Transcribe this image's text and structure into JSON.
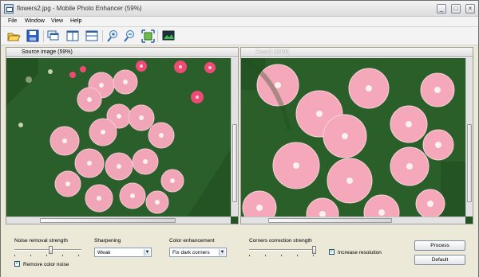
{
  "window": {
    "title": "flowers2.jpg - Mobile Photo Enhancer (59%)",
    "controls": [
      "_",
      "□",
      "×"
    ]
  },
  "menu": [
    "File",
    "Window",
    "View",
    "Help"
  ],
  "toolbar": {
    "buttons": [
      "open-folder-icon",
      "save-icon",
      "cascade-windows-icon",
      "split-vertical-icon",
      "split-horizontal-icon",
      "zoom-in-icon",
      "zoom-out-icon",
      "fit-to-window-icon",
      "show-original-icon"
    ]
  },
  "source_panel": {
    "title": "Source image (59%)"
  },
  "result_panel": {
    "title": "Result (59%)"
  },
  "controls": {
    "noise": {
      "label": "Noise removal strength",
      "level": 0.55,
      "remove_color_noise": {
        "label": "Remove color noise",
        "checked": true
      }
    },
    "sharpening": {
      "label": "Sharpening",
      "value": "Weak"
    },
    "color_enhancement": {
      "label": "Color enhancement",
      "value": "Fix dark corners"
    },
    "corners": {
      "label": "Corners correction strength",
      "level": 1.0
    },
    "increase_resolution": {
      "label": "Increase resolution",
      "checked": true
    },
    "process_label": "Process",
    "default_label": "Default"
  },
  "colors": {
    "petal": "#f3a5b7",
    "foliage": "#2f6a2e",
    "accent": "#d92b53"
  }
}
